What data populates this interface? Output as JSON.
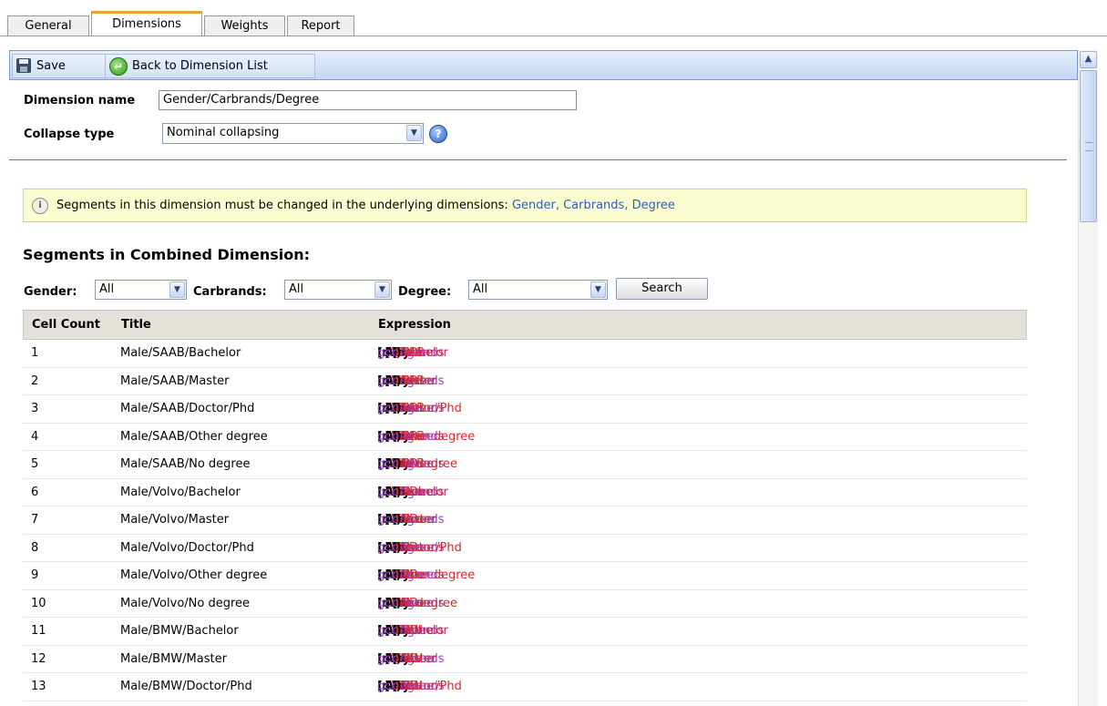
{
  "tabs": [
    {
      "label": "General",
      "active": false
    },
    {
      "label": "Dimensions",
      "active": true
    },
    {
      "label": "Weights",
      "active": false
    },
    {
      "label": "Report",
      "active": false
    }
  ],
  "toolbar": {
    "save_label": "Save",
    "back_label": "Back to Dimension List"
  },
  "form": {
    "name_label": "Dimension name",
    "name_value": "Gender/Carbrands/Degree",
    "collapse_label": "Collapse type",
    "collapse_value": "Nominal collapsing"
  },
  "info": {
    "text": "Segments in this dimension must be changed in the underlying dimensions:",
    "links": [
      "Gender",
      "Carbrands",
      "Degree"
    ]
  },
  "segments_heading": "Segments in Combined Dimension:",
  "filters": {
    "gender_label": "Gender:",
    "gender_value": "All",
    "carbrands_label": "Carbrands:",
    "carbrands_value": "All",
    "degree_label": "Degree:",
    "degree_value": "All",
    "search_label": "Search"
  },
  "table": {
    "headers": [
      "Cell Count",
      "Title",
      "Expression"
    ],
    "rows": [
      {
        "count": "1",
        "title": "Male/SAAB/Bachelor",
        "gender": "Male",
        "brand": "SAAB",
        "degree": "Bachelor"
      },
      {
        "count": "2",
        "title": "Male/SAAB/Master",
        "gender": "Male",
        "brand": "SAAB",
        "degree": "Master"
      },
      {
        "count": "3",
        "title": "Male/SAAB/Doctor/Phd",
        "gender": "Male",
        "brand": "SAAB",
        "degree": "Doctor/Phd"
      },
      {
        "count": "4",
        "title": "Male/SAAB/Other degree",
        "gender": "Male",
        "brand": "SAAB",
        "degree": "Other degree"
      },
      {
        "count": "5",
        "title": "Male/SAAB/No degree",
        "gender": "Male",
        "brand": "SAAB",
        "degree": "No degree"
      },
      {
        "count": "6",
        "title": "Male/Volvo/Bachelor",
        "gender": "Male",
        "brand": "Volvo",
        "degree": "Bachelor"
      },
      {
        "count": "7",
        "title": "Male/Volvo/Master",
        "gender": "Male",
        "brand": "Volvo",
        "degree": "Master"
      },
      {
        "count": "8",
        "title": "Male/Volvo/Doctor/Phd",
        "gender": "Male",
        "brand": "Volvo",
        "degree": "Doctor/Phd"
      },
      {
        "count": "9",
        "title": "Male/Volvo/Other degree",
        "gender": "Male",
        "brand": "Volvo",
        "degree": "Other degree"
      },
      {
        "count": "10",
        "title": "Male/Volvo/No degree",
        "gender": "Male",
        "brand": "Volvo",
        "degree": "No degree"
      },
      {
        "count": "11",
        "title": "Male/BMW/Bachelor",
        "gender": "Male",
        "brand": "BMW",
        "degree": "Bachelor"
      },
      {
        "count": "12",
        "title": "Male/BMW/Master",
        "gender": "Male",
        "brand": "BMW",
        "degree": "Master"
      },
      {
        "count": "13",
        "title": "Male/BMW/Doctor/Phd",
        "gender": "Male",
        "brand": "BMW",
        "degree": "Doctor/Phd"
      }
    ]
  },
  "expr": {
    "fn_in": "In",
    "fn_any": "Any",
    "and": "AND",
    "var_gender": "gender",
    "var_carbrands": "carbrands",
    "var_degree": "degree"
  }
}
